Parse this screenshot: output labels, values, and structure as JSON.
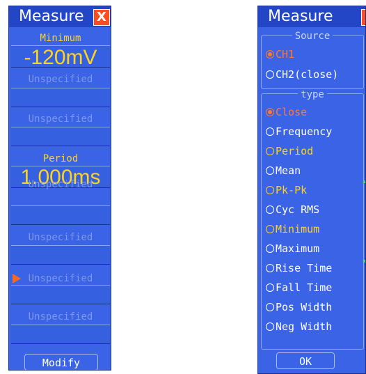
{
  "left_panel": {
    "title": "Measure",
    "close_glyph": "X",
    "slots": [
      {
        "label": "Minimum",
        "value": "-120mV",
        "state": "active"
      },
      {
        "label": "Unspecified",
        "value": "",
        "state": "empty"
      },
      {
        "label": "Unspecified",
        "value": "",
        "state": "empty"
      },
      {
        "label": "Period",
        "value": "1.000ms",
        "state": "active"
      },
      {
        "label": "Unspecified",
        "value": "",
        "state": "empty"
      },
      {
        "label": "Unspecified",
        "value": "",
        "state": "empty"
      },
      {
        "label": "Unspecified",
        "value": "",
        "state": "pointer"
      },
      {
        "label": "Unspecified",
        "value": "",
        "state": "empty"
      }
    ],
    "modify_label": "Modify"
  },
  "right_panel": {
    "title": "Measure",
    "close_glyph": "X",
    "source": {
      "legend": "Source",
      "options": [
        {
          "label": "CH1",
          "state": "selected"
        },
        {
          "label": "CH2(close)",
          "state": "normal"
        }
      ]
    },
    "type": {
      "legend": "type",
      "options": [
        {
          "label": "Close",
          "state": "selected"
        },
        {
          "label": "Frequency",
          "state": "normal"
        },
        {
          "label": "Period",
          "state": "chosen"
        },
        {
          "label": "Mean",
          "state": "normal"
        },
        {
          "label": "Pk-Pk",
          "state": "chosen"
        },
        {
          "label": "Cyc RMS",
          "state": "normal"
        },
        {
          "label": "Minimum",
          "state": "chosen"
        },
        {
          "label": "Maximum",
          "state": "normal"
        },
        {
          "label": "Rise Time",
          "state": "normal"
        },
        {
          "label": "Fall Time",
          "state": "normal"
        },
        {
          "label": "Pos Width",
          "state": "normal"
        },
        {
          "label": "Neg Width",
          "state": "normal"
        }
      ]
    },
    "ok_label": "OK",
    "scroll_icons": [
      "arrow-up-icon",
      "arrow-down-icon"
    ]
  },
  "colors": {
    "panel": "#3a63e6",
    "title_bar": "#2346c7",
    "close": "#ff4d1f",
    "active_text": "#ffd21f",
    "selected_text": "#ff7a2a",
    "empty_text": "#7d97ea",
    "scroll_arrow": "#2ee85a"
  }
}
